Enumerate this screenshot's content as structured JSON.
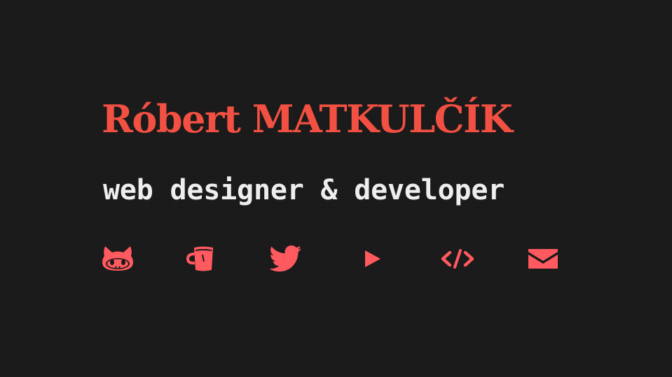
{
  "hero": {
    "name": "Róbert MATKULČÍK",
    "tagline": "web designer & developer"
  },
  "social_links": [
    {
      "icon": "github-octocat-icon"
    },
    {
      "icon": "mug-icon"
    },
    {
      "icon": "twitter-bird-icon"
    },
    {
      "icon": "play-icon"
    },
    {
      "icon": "code-icon"
    },
    {
      "icon": "mail-icon"
    }
  ],
  "colors": {
    "background": "#1b1a1a",
    "accent": "#f25042",
    "icon": "#ff5a5f",
    "text": "#eeeeee"
  }
}
